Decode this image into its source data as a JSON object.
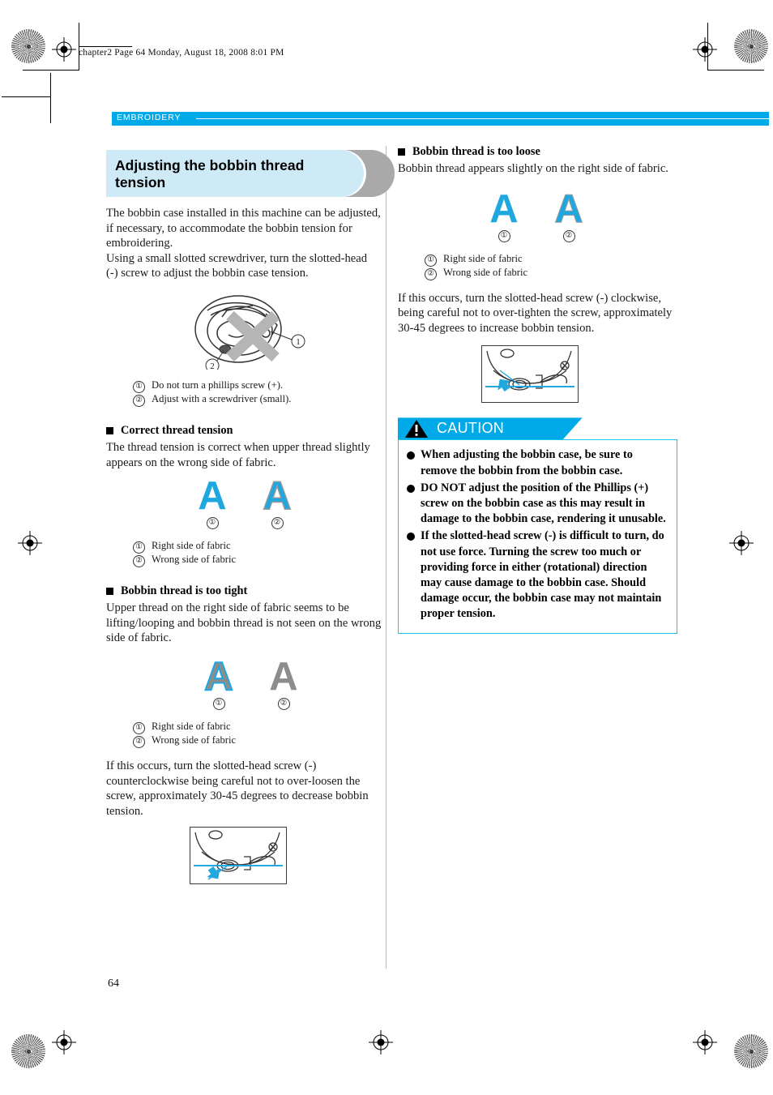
{
  "printer_marks": {
    "file_stamp": "chapter2  Page 64  Monday, August 18, 2008  8:01 PM"
  },
  "section_bar": {
    "label": "EMBROIDERY"
  },
  "left_column": {
    "heading": "Adjusting the bobbin thread tension",
    "intro_paragraph_1": "The bobbin case installed in this machine can be adjusted, if necessary, to accommodate the bobbin tension for embroidering.",
    "intro_paragraph_2": "Using a small slotted screwdriver, turn the slotted-head (-) screw to adjust the bobbin case tension.",
    "bobbin_case_legend": [
      {
        "num": "①",
        "text": "Do not turn a phillips screw (+)."
      },
      {
        "num": "②",
        "text": "Adjust with a screwdriver (small)."
      }
    ],
    "correct_tension": {
      "heading": "Correct thread tension",
      "body": "The thread tension is correct when upper thread slightly appears on the wrong side of fabric.",
      "samples": [
        {
          "glyph": "A",
          "num": "①"
        },
        {
          "glyph": "A",
          "num": "②"
        }
      ],
      "legend": [
        {
          "num": "①",
          "text": "Right side of fabric"
        },
        {
          "num": "②",
          "text": "Wrong side of fabric"
        }
      ]
    },
    "too_tight": {
      "heading": "Bobbin thread is too tight",
      "body": "Upper thread on the right side of fabric seems to be lifting/looping and bobbin thread is not seen on the wrong side of fabric.",
      "samples": [
        {
          "glyph": "A",
          "num": "①"
        },
        {
          "glyph": "A",
          "num": "②"
        }
      ],
      "legend": [
        {
          "num": "①",
          "text": "Right side of fabric"
        },
        {
          "num": "②",
          "text": "Wrong side of fabric"
        }
      ],
      "remedy": "If this occurs, turn the slotted-head screw (-) counterclockwise being careful not to over-loosen the screw, approximately 30-45 degrees to decrease bobbin tension."
    }
  },
  "right_column": {
    "too_loose": {
      "heading": "Bobbin thread is too loose",
      "body": "Bobbin thread appears slightly on the right side of fabric.",
      "samples": [
        {
          "glyph": "A",
          "num": "①"
        },
        {
          "glyph": "A",
          "num": "②"
        }
      ],
      "legend": [
        {
          "num": "①",
          "text": "Right side of fabric"
        },
        {
          "num": "②",
          "text": "Wrong side of fabric"
        }
      ],
      "remedy": "If this occurs, turn the slotted-head screw (-) clockwise, being careful not to over-tighten the screw, approximately 30-45 degrees to increase bobbin tension."
    },
    "caution": {
      "title": "CAUTION",
      "items": [
        "When adjusting the bobbin case, be sure to remove the bobbin from the bobbin case.",
        "DO NOT adjust the position of the Phillips (+) screw on the bobbin case as this may result in damage to the bobbin case, rendering it unusable.",
        "If the slotted-head screw (-) is difficult to turn, do not use force. Turning the screw too much or providing force in either (rotational) direction may cause damage to the bobbin case. Should damage occur, the bobbin case may not maintain proper tension."
      ]
    }
  },
  "footer": {
    "page_number": "64"
  },
  "colors": {
    "accent_cyan": "#00a9e8",
    "banner_light_blue": "#cfeaf7",
    "caution_border": "#13c7e8",
    "fabric_blue": "#1fa8e0",
    "fabric_gray": "#8d8d8d"
  }
}
